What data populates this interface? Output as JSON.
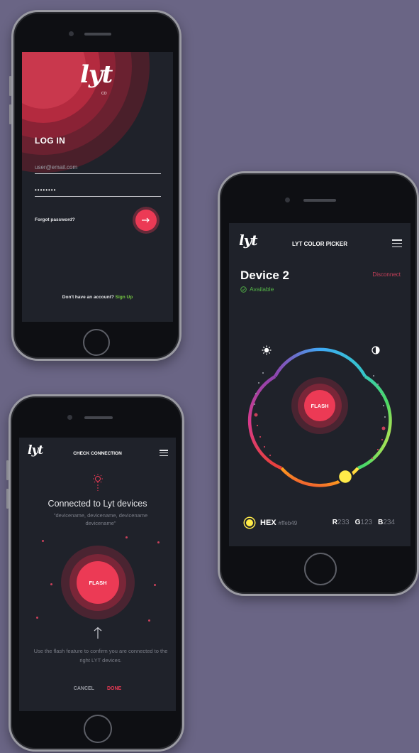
{
  "login": {
    "logo": "lyt",
    "logo_sub": "CO",
    "title": "LOG IN",
    "email_placeholder": "user@email.com",
    "password_value": "••••••••",
    "forgot_label": "Forgot password?",
    "go_icon": "arrow-right-icon",
    "signup_prompt": "Don't have an account?",
    "signup_link": "Sign Up"
  },
  "picker": {
    "logo": "lyt",
    "header_title": "LYT COLOR PICKER",
    "device_name": "Device 2",
    "status": "Available",
    "disconnect_label": "Disconnect",
    "flash_label": "FLASH",
    "brightness_icon": "sun-icon",
    "contrast_icon": "half-circle-icon",
    "hex_label": "HEX",
    "hex_value": "#ffeb49",
    "r_label": "R",
    "r_value": "233",
    "g_label": "G",
    "g_value": "123",
    "b_label": "B",
    "b_value": "234"
  },
  "connection": {
    "logo": "lyt",
    "header_title": "CHECK CONNECTION",
    "heading": "Connected to Lyt devices",
    "device_names": "\"devicename, devicename, devicename devicename\"",
    "flash_label": "FLASH",
    "arrow_icon": "arrow-up-icon",
    "info_text": "Use the flash feature to confirm you are connected to the right LYT devices.",
    "cancel_label": "CANCEL",
    "done_label": "DONE"
  },
  "colors": {
    "background": "#6a6585",
    "screen": "#1f222a",
    "accent": "#ec3a55",
    "available": "#54b548",
    "selected_color": "#ffeb49"
  }
}
